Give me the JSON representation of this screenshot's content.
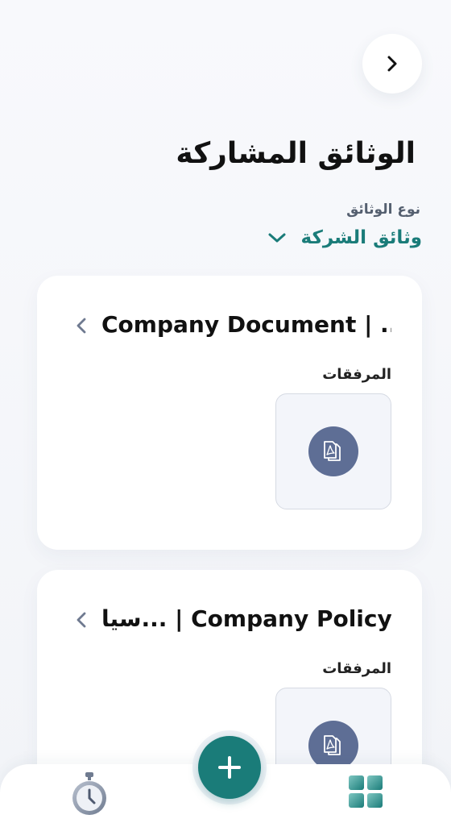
{
  "header": {
    "back_icon": "chevron-right-icon",
    "title": "الوثائق المشاركة"
  },
  "filter": {
    "label": "نوع الوثائق",
    "value": "وثائق الشركة",
    "dropdown_icon": "chevron-down-icon"
  },
  "documents": [
    {
      "title": "Company Document | ...",
      "attachments_label": "المرفقات",
      "attachment_icon": "pdf-file-icon",
      "open_icon": "chevron-left-icon"
    },
    {
      "title": "سيا... | Company Policy",
      "attachments_label": "المرفقات",
      "attachment_icon": "pdf-file-icon",
      "open_icon": "chevron-left-icon"
    }
  ],
  "bottom_nav": {
    "left_icon": "stopwatch-icon",
    "center_icon": "plus-icon",
    "right_icon": "grid-icon"
  },
  "colors": {
    "accent": "#1a7c79",
    "pdf_icon_bg": "#5e6e95",
    "background": "#f3f5f9"
  }
}
